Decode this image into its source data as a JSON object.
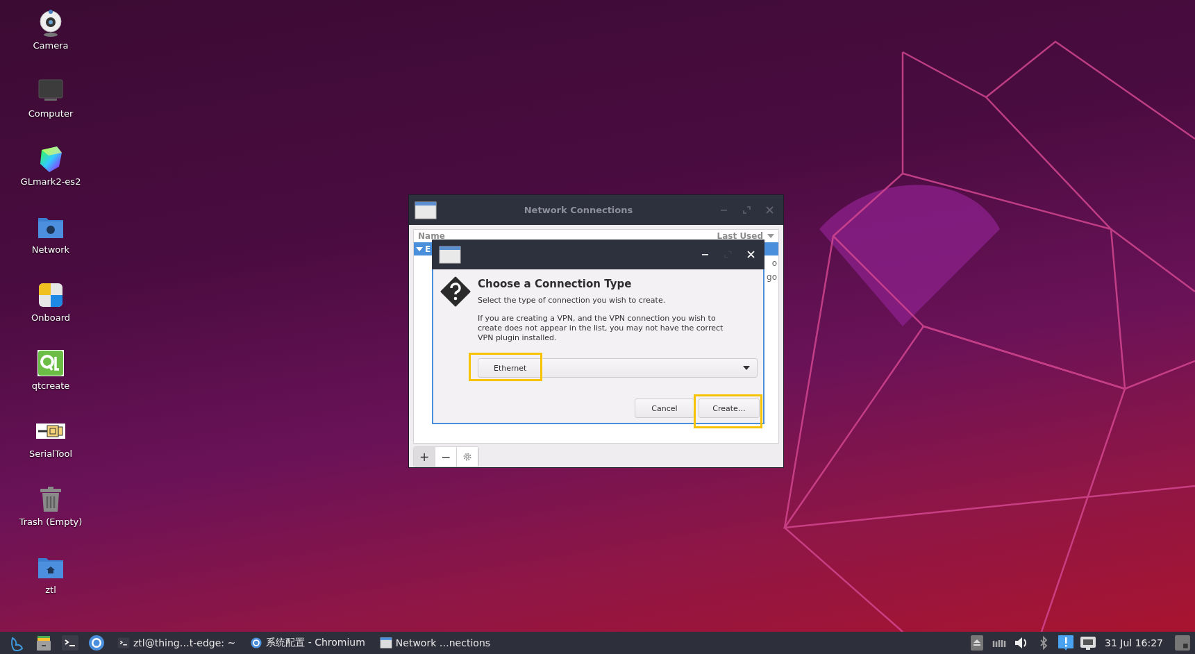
{
  "desktop_icons": [
    {
      "label": "Camera",
      "kind": "camera"
    },
    {
      "label": "Computer",
      "kind": "monitor"
    },
    {
      "label": "GLmark2-es2",
      "kind": "cube"
    },
    {
      "label": "Network",
      "kind": "globe-folder"
    },
    {
      "label": "Onboard",
      "kind": "tiles"
    },
    {
      "label": "qtcreate",
      "kind": "qt"
    },
    {
      "label": "SerialTool",
      "kind": "serial"
    },
    {
      "label": "Trash (Empty)",
      "kind": "trash"
    },
    {
      "label": "ztl",
      "kind": "home-folder"
    }
  ],
  "main_window": {
    "title": "Network Connections",
    "columns": [
      "Name",
      "Last Used"
    ],
    "groups": [
      {
        "name": "E",
        "expanded": true,
        "selected": true
      }
    ],
    "column_2_fragments": [
      "o",
      "go"
    ],
    "toolbar": [
      {
        "kind": "text",
        "label": "+",
        "selected": true
      },
      {
        "kind": "text",
        "label": "−",
        "selected": false
      },
      {
        "kind": "gear",
        "selected": false
      }
    ]
  },
  "dialog": {
    "title": "Choose a Connection Type",
    "subtitle": "Select the type of connection you wish to create.",
    "note": "If you are creating a VPN, and the VPN connection you wish to create does not appear in the list, you may not have the correct VPN plugin installed.",
    "connection_type": {
      "value": "Ethernet",
      "highlighted": true
    },
    "buttons": [
      {
        "label": "Cancel",
        "highlighted": false
      },
      {
        "label": "Create…",
        "highlighted": true
      }
    ]
  },
  "taskbar": {
    "launchers": [
      {
        "kind": "start"
      },
      {
        "kind": "files"
      },
      {
        "kind": "terminal"
      },
      {
        "kind": "browser"
      }
    ],
    "tasks": [
      {
        "label": "ztl@thing…t-edge: ~",
        "kind": "terminal"
      },
      {
        "label": "系统配置 - Chromium",
        "kind": "browser"
      },
      {
        "label": "Network …nections",
        "kind": "window"
      }
    ],
    "tray": [
      {
        "kind": "eject"
      },
      {
        "kind": "network"
      },
      {
        "kind": "volume"
      },
      {
        "kind": "bluetooth"
      },
      {
        "kind": "notification"
      },
      {
        "kind": "ethernet"
      }
    ],
    "clock": "31 Jul 16:27"
  }
}
